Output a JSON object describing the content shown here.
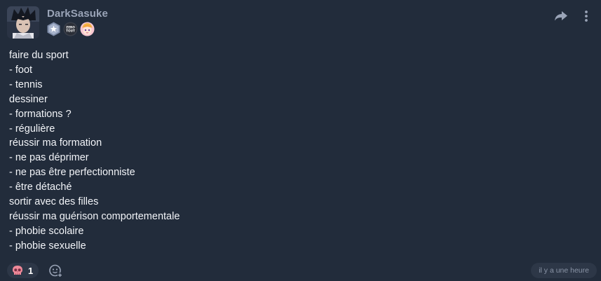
{
  "post": {
    "author": "DarkSasuke",
    "badges": [
      {
        "icon": "star-badge-icon"
      },
      {
        "icon": "zero-tout-badge-icon",
        "label": "ZERO TOUT"
      },
      {
        "icon": "anime-avatar-badge-icon"
      }
    ],
    "lines": [
      "faire du sport",
      "- foot",
      "- tennis",
      "dessiner",
      "- formations ?",
      "- régulière",
      "réussir ma formation",
      "- ne pas déprimer",
      "- ne pas être perfectionniste",
      "- être détaché",
      "sortir avec des filles",
      "réussir ma guérison comportementale",
      "- phobie scolaire",
      "- phobie sexuelle"
    ],
    "reaction": {
      "icon": "skull-emoji-icon",
      "count": "1"
    },
    "timestamp": "il y a une heure"
  },
  "colors": {
    "background": "#222c3b",
    "author": "#9aa4b7",
    "pill": "#2d3747",
    "muted": "#8a94a6"
  }
}
